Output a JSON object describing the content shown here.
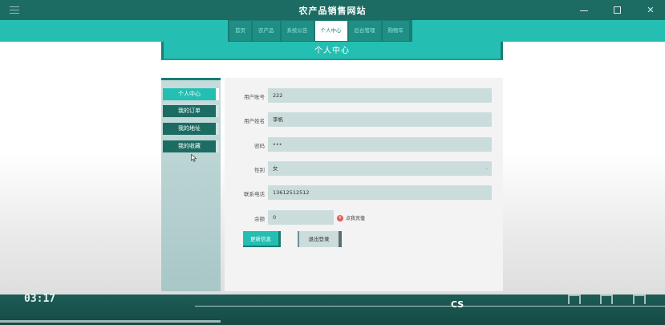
{
  "window": {
    "title": "农产品销售网站",
    "minimize_label": "–",
    "maximize_label": "□",
    "close_label": "✕"
  },
  "nav": {
    "items": [
      "首页",
      "农产品",
      "系统公告",
      "个人中心",
      "后台管理",
      "购物车"
    ],
    "active_index": 3
  },
  "banner": {
    "title": "个人中心"
  },
  "sidebar": {
    "items": [
      "个人中心",
      "我的订单",
      "我的地址",
      "我的收藏"
    ],
    "active_index": 0
  },
  "form": {
    "account": {
      "label": "用户账号",
      "value": "222"
    },
    "name": {
      "label": "用户姓名",
      "value": "李帆"
    },
    "password": {
      "label": "密码",
      "value": "•••"
    },
    "gender": {
      "label": "性别",
      "value": "女"
    },
    "phone": {
      "label": "联系电话",
      "value": "13612512512"
    },
    "balance": {
      "label": "余额",
      "value": "0"
    },
    "recharge_label": "点我充值",
    "update_button": "更新信息",
    "logout_button": "退出登录"
  },
  "video": {
    "time": "03:17",
    "watermark": "CS"
  },
  "colors": {
    "titlebar": "#1c6c63",
    "accent": "#24bfb2",
    "dark_accent": "#1a7c73",
    "field_bg": "#cbdcdc"
  }
}
